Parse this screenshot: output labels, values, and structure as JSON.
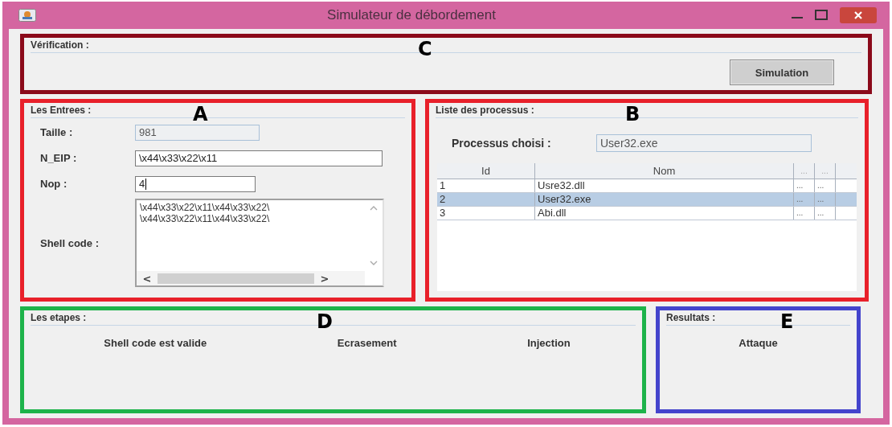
{
  "window": {
    "title": "Simulateur de débordement"
  },
  "verification": {
    "letter": "C",
    "color": "#8b0a1a",
    "title": "Vérification :",
    "button": "Simulation"
  },
  "inputs": {
    "letter": "A",
    "color": "#e8202a",
    "title": "Les Entrees :",
    "fields": [
      {
        "label": "Taille :",
        "value": "981",
        "kind": "readonly"
      },
      {
        "label": "N_EIP :",
        "value": "\\x44\\x33\\x22\\x11",
        "kind": "wide"
      },
      {
        "label": "Nop :",
        "value": "4",
        "kind": "short"
      }
    ],
    "shellcode": {
      "label": "Shell code :",
      "lines": [
        "\\x44\\x33\\x22\\x11\\x44\\x33\\x22\\",
        "\\x44\\x33\\x22\\x11\\x44\\x33\\x22\\"
      ],
      "left_arrow": "<",
      "right_arrow": ">"
    }
  },
  "processes": {
    "letter": "B",
    "color": "#e8202a",
    "title": "Liste des processus :",
    "chosen_label": "Processus choisi :",
    "chosen_value": "User32.exe",
    "table": {
      "columns": [
        "Id",
        "Nom",
        "...",
        "..."
      ],
      "rows": [
        {
          "cells": [
            "1",
            "Usre32.dll",
            "...",
            "..."
          ],
          "selected": false
        },
        {
          "cells": [
            "2",
            "User32.exe",
            "...",
            "..."
          ],
          "selected": true
        },
        {
          "cells": [
            "3",
            "Abi.dll",
            "...",
            "..."
          ],
          "selected": false
        }
      ]
    }
  },
  "steps": {
    "letter": "D",
    "color": "#1db34a",
    "title": "Les etapes :",
    "items": [
      "Shell code est valide",
      "Ecrasement",
      "Injection"
    ]
  },
  "results": {
    "letter": "E",
    "color": "#4444cc",
    "title": "Resultats :",
    "items": [
      "Attaque"
    ]
  }
}
